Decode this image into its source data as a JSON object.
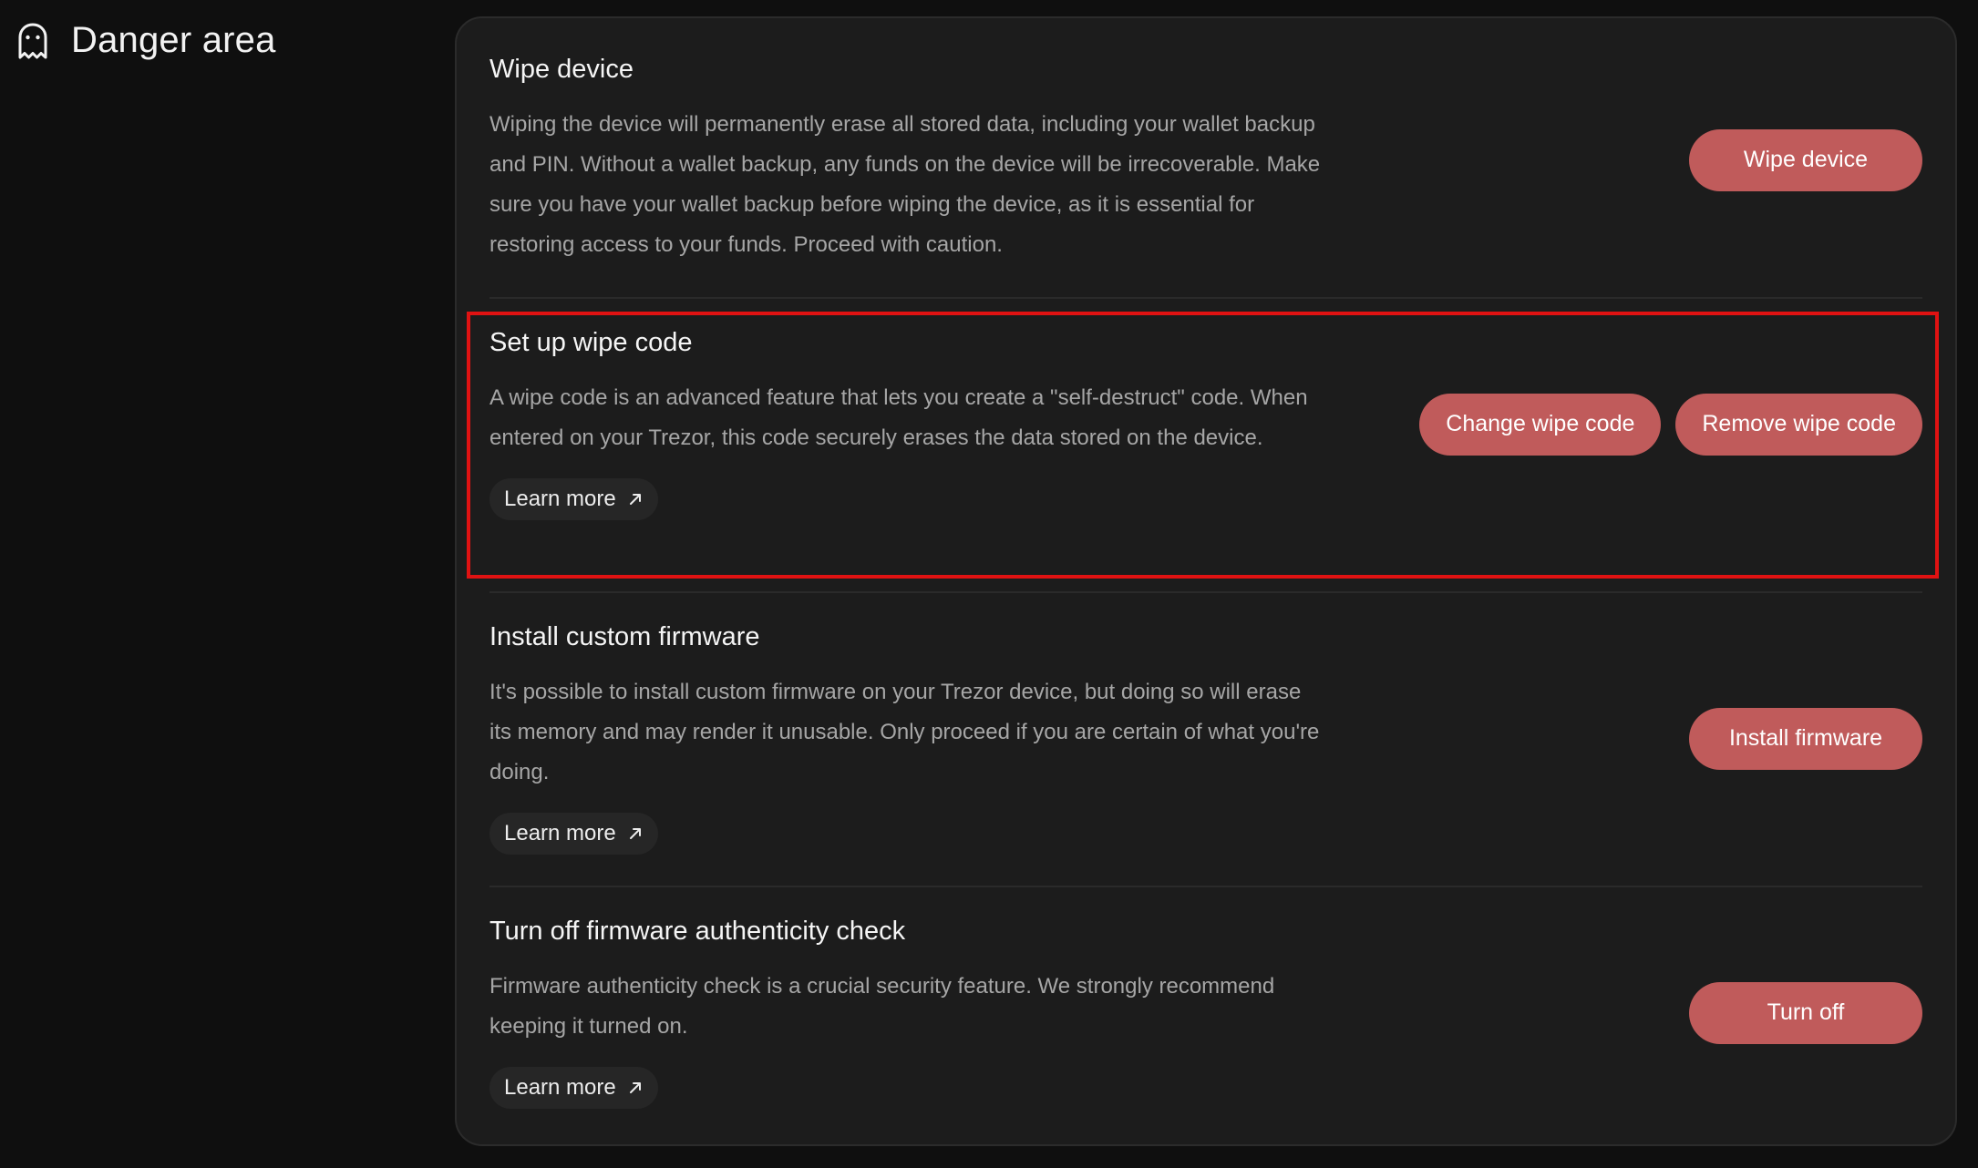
{
  "header": {
    "icon": "ghost-icon",
    "title": "Danger area"
  },
  "colors": {
    "button": "#c05b5b",
    "highlight": "#e01212",
    "card": "#1c1c1c",
    "background": "#0f0f0f"
  },
  "rows": [
    {
      "title": "Wipe device",
      "description": "Wiping the device will permanently erase all stored data, including your wallet backup and PIN. Without a wallet backup, any funds on the device will be irrecoverable. Make sure you have your wallet backup before wiping the device, as it is essential for restoring access to your funds. Proceed with caution.",
      "buttons": [
        "Wipe device"
      ]
    },
    {
      "title": "Set up wipe code",
      "description": "A wipe code is an advanced feature that lets you create a \"self-destruct\" code. When entered on your Trezor, this code securely erases the data stored on the device.",
      "learn_more": "Learn more",
      "buttons": [
        "Change wipe code",
        "Remove wipe code"
      ]
    },
    {
      "title": "Install custom firmware",
      "description": "It's possible to install custom firmware on your Trezor device, but doing so will erase its memory and may render it unusable. Only proceed if you are certain of what you're doing.",
      "learn_more": "Learn more",
      "buttons": [
        "Install firmware"
      ]
    },
    {
      "title": "Turn off firmware authenticity check",
      "description": "Firmware authenticity check is a crucial security feature. We strongly recommend keeping it turned on.",
      "learn_more": "Learn more",
      "buttons": [
        "Turn off"
      ]
    }
  ]
}
